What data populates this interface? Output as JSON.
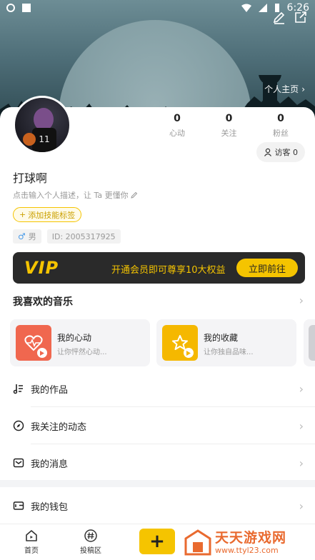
{
  "status_bar": {
    "time": "6:26"
  },
  "header": {
    "homepage_link": "个人主页"
  },
  "stats": [
    {
      "count": "0",
      "label": "心动"
    },
    {
      "count": "0",
      "label": "关注"
    },
    {
      "count": "0",
      "label": "粉丝"
    }
  ],
  "visitor_button": "访客 0",
  "profile": {
    "username": "打球啊",
    "description_placeholder": "点击输入个人描述，让 Ta 更懂你",
    "add_tag_button": "添加技能标签",
    "gender": "男",
    "user_id": "ID: 2005317925"
  },
  "vip_banner": {
    "logo": "VIP",
    "text": "开通会员即可尊享10大权益",
    "button": "立即前往"
  },
  "music_section": {
    "title": "我喜欢的音乐",
    "cards": [
      {
        "title": "我的心动",
        "subtitle": "让你怦然心动...",
        "icon": "heartbeat-icon",
        "color": "#f0674f"
      },
      {
        "title": "我的收藏",
        "subtitle": "让你独自品味...",
        "icon": "star-icon",
        "color": "#f5b800"
      }
    ]
  },
  "menu": [
    {
      "label": "我的作品",
      "icon": "music-note-icon"
    },
    {
      "label": "我关注的动态",
      "icon": "compass-icon"
    },
    {
      "label": "我的消息",
      "icon": "message-icon"
    },
    {
      "label": "我的钱包",
      "icon": "wallet-icon"
    }
  ],
  "bottom_nav": [
    {
      "label": "首页",
      "icon": "home-icon"
    },
    {
      "label": "投稿区",
      "icon": "hashtag-icon"
    }
  ],
  "watermark": {
    "name": "天天游戏网",
    "url": "www.ttyl23.com"
  },
  "colors": {
    "accent": "#f5c400",
    "vip_bg": "#2a2a2a"
  }
}
